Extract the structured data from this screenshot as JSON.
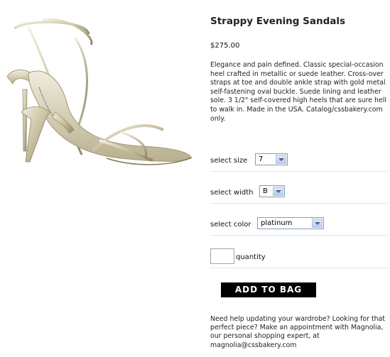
{
  "product": {
    "title": "Strappy Evening Sandals",
    "price": "$275.00",
    "description": "Elegance and pain defined. Classic special-occasion heel crafted in metallic or suede leather. Cross-over straps at toe and double ankle strap with gold metal self-fastening oval buckle. Suede lining and leather sole. 3 1/2\" self-covered high heels that are sure hell to walk  in.  Made in the USA. Catalog/cssbakery.com only."
  },
  "options": {
    "size": {
      "label": "select size",
      "value": "7"
    },
    "width": {
      "label": "select width",
      "value": "B"
    },
    "color": {
      "label": "select color",
      "value": "platinum"
    }
  },
  "quantity": {
    "label": "quantity",
    "value": ""
  },
  "add_to_bag": {
    "label": "ADD TO BAG"
  },
  "help_text": "Need help updating your wardrobe? Looking for that perfect piece? Make an appointment with Magnolia, our personal shopping expert, at magnolia@cssbakery.com",
  "colors": {
    "button_bg": "#000000",
    "button_text": "#ffffff",
    "metal": "#cfc8a8",
    "divider": "#e6e6e6"
  }
}
